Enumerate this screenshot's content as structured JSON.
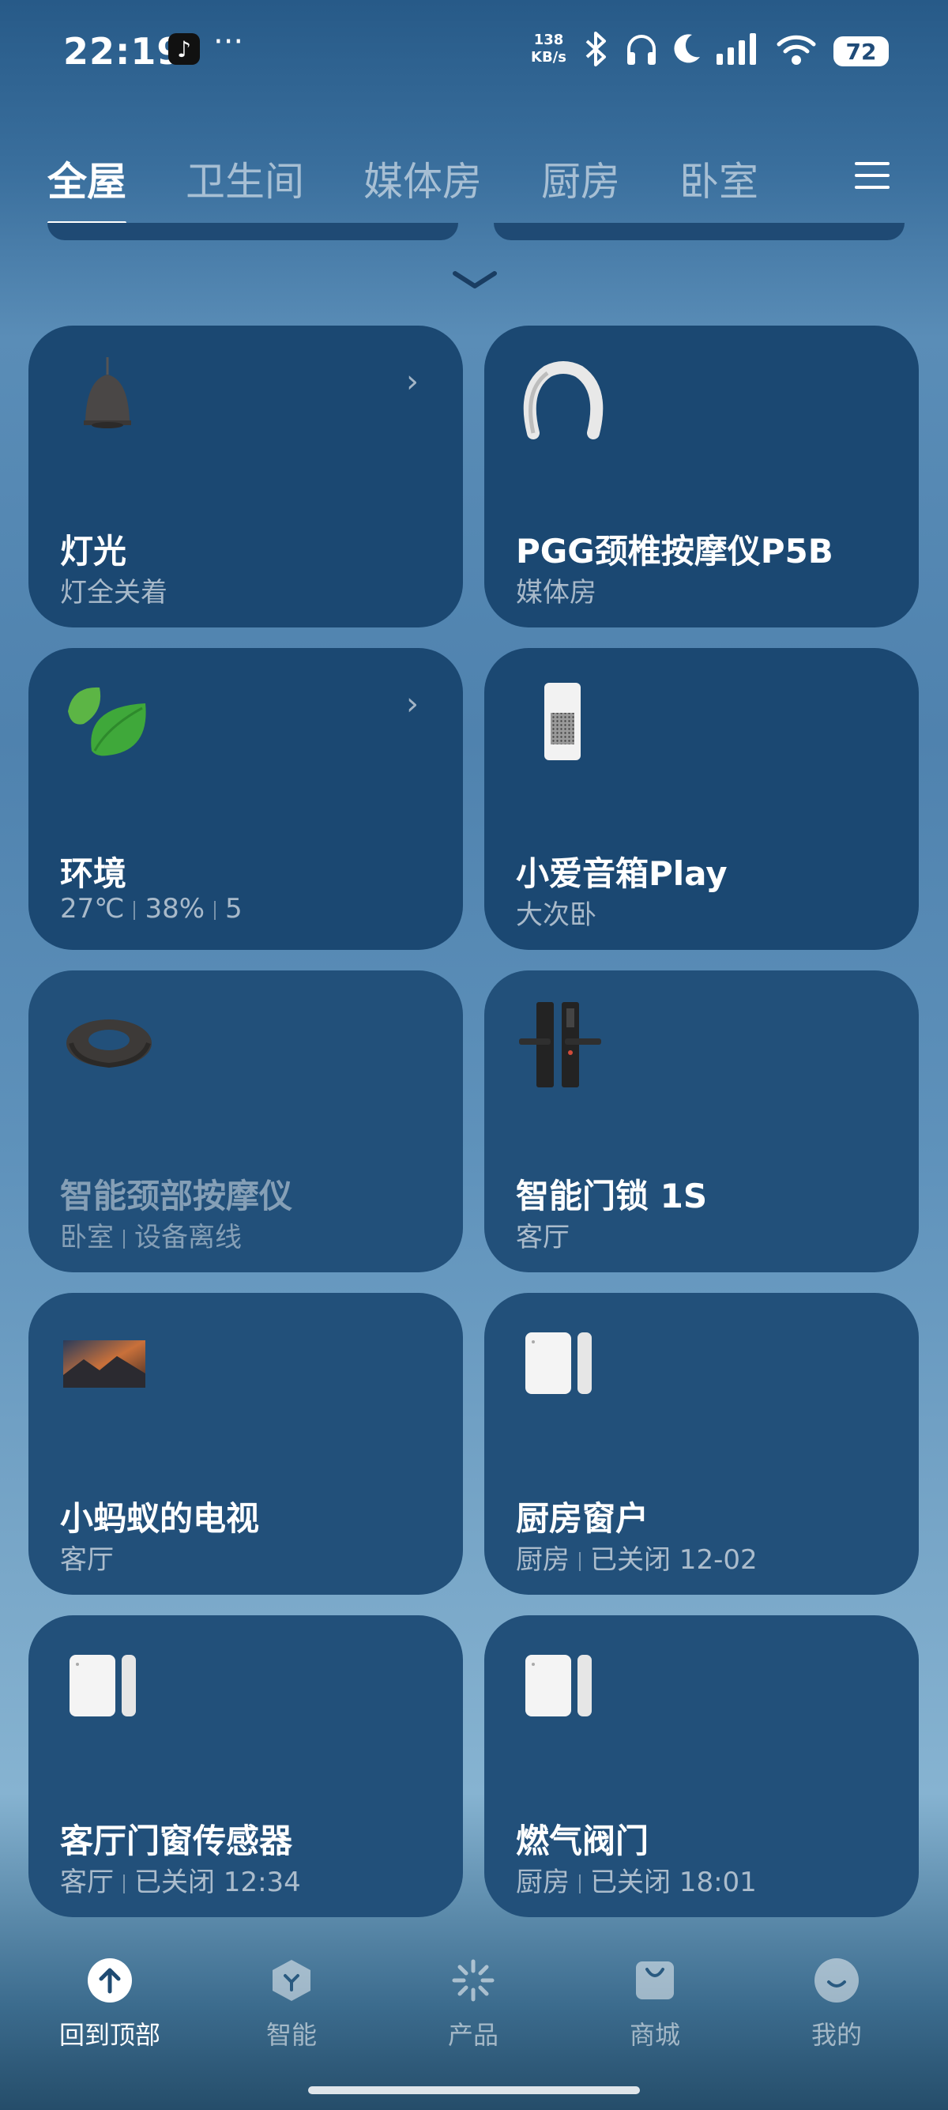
{
  "status_bar": {
    "time": "22:19",
    "app_icon": "tiktok-icon",
    "more": "···",
    "net_speed_value": "138",
    "net_speed_unit": "KB/s",
    "battery": "72"
  },
  "tabs": [
    {
      "label": "全屋"
    },
    {
      "label": "卫生间"
    },
    {
      "label": "媒体房"
    },
    {
      "label": "厨房"
    },
    {
      "label": "卧室"
    }
  ],
  "cards": [
    {
      "name": "灯光",
      "sub": [
        "灯全关着"
      ],
      "icon": "pendant-lamp-icon"
    },
    {
      "name": "PGG颈椎按摩仪P5B",
      "sub": [
        "媒体房"
      ],
      "icon": "neck-massager-icon"
    },
    {
      "name": "环境",
      "sub": [
        "27℃",
        "38%",
        "5"
      ],
      "icon": "leaf-icon"
    },
    {
      "name": "小爱音箱Play",
      "sub": [
        "大次卧"
      ],
      "icon": "speaker-icon"
    },
    {
      "name": "智能颈部按摩仪",
      "sub": [
        "卧室",
        "设备离线"
      ],
      "icon": "neck-pillow-icon"
    },
    {
      "name": "智能门锁 1S",
      "sub": [
        "客厅"
      ],
      "icon": "door-lock-icon"
    },
    {
      "name": "小蚂蚁的电视",
      "sub": [
        "客厅"
      ],
      "icon": "tv-icon"
    },
    {
      "name": "厨房窗户",
      "sub": [
        "厨房",
        "已关闭 12-02"
      ],
      "icon": "window-sensor-icon"
    },
    {
      "name": "客厅门窗传感器",
      "sub": [
        "客厅",
        "已关闭 12:34"
      ],
      "icon": "window-sensor-icon"
    },
    {
      "name": "燃气阀门",
      "sub": [
        "厨房",
        "已关闭 18:01"
      ],
      "icon": "window-sensor-icon"
    }
  ],
  "bottom_nav": [
    {
      "label": "回到顶部",
      "icon": "arrow-up-icon"
    },
    {
      "label": "智能",
      "icon": "smart-icon"
    },
    {
      "label": "产品",
      "icon": "product-icon"
    },
    {
      "label": "商城",
      "icon": "shop-bag-icon"
    },
    {
      "label": "我的",
      "icon": "profile-icon"
    }
  ]
}
